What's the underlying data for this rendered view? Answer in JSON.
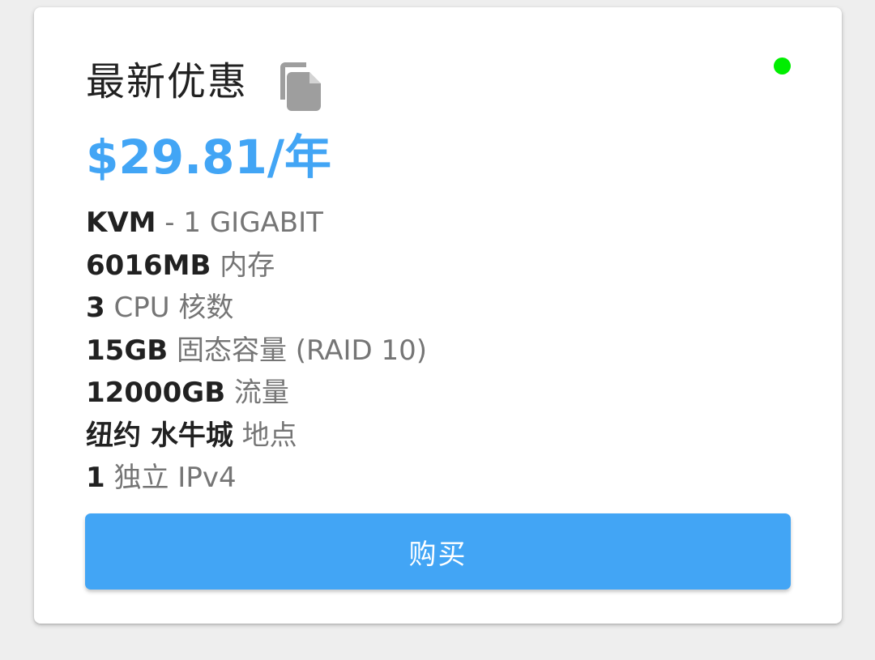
{
  "card": {
    "title": "最新优惠",
    "copy_icon": "copy-icon",
    "status_color": "#00ee00",
    "price": "$29.81/年",
    "specs": [
      {
        "value": "KVM",
        "label": " - 1 GIGABIT"
      },
      {
        "value": "6016MB",
        "label": " 内存"
      },
      {
        "value": "3",
        "label": " CPU 核数"
      },
      {
        "value": "15GB",
        "label": " 固态容量 (RAID 10)"
      },
      {
        "value": "12000GB",
        "label": " 流量"
      },
      {
        "value": "纽约 水牛城",
        "label": " 地点"
      },
      {
        "value": "1",
        "label": " 独立 IPv4"
      }
    ],
    "buy_label": "购买"
  },
  "colors": {
    "accent": "#42a5f5",
    "background": "#eeeeee",
    "card": "#ffffff"
  }
}
